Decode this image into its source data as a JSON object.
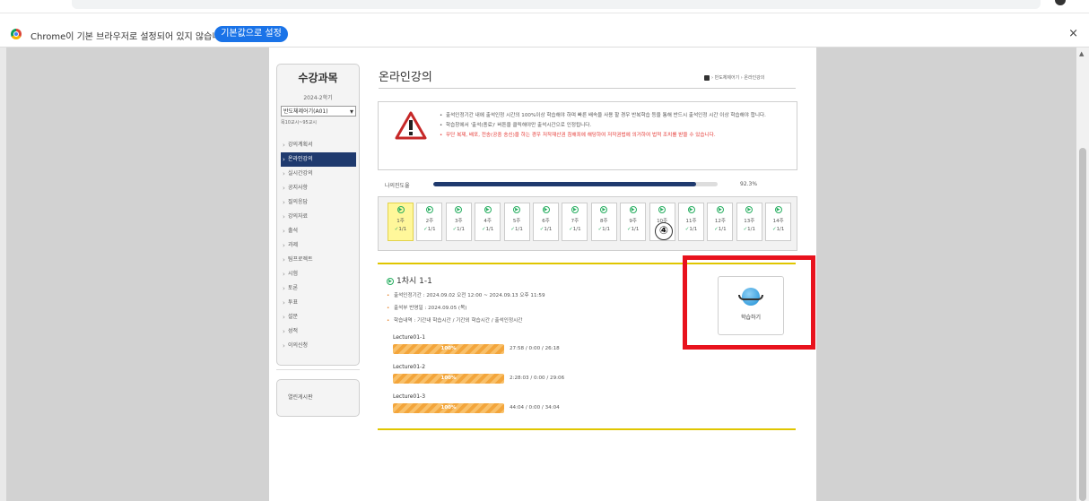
{
  "infobar": {
    "message": "Chrome이 기본 브라우저로 설정되어 있지 않습니다",
    "button_label": "기본값으로 설정",
    "close_glyph": "×"
  },
  "scrollbar": {
    "up_glyph": "▲"
  },
  "sidebar": {
    "title": "수강과목",
    "semester": "2024-2학기",
    "course_select": "반도체제어기(A01)",
    "course_sub": "목10교시~95교시",
    "menu": [
      "강의계획서",
      "온라인강의",
      "실시간강의",
      "공지사항",
      "질의응답",
      "강의자료",
      "출석",
      "과제",
      "팀프로젝트",
      "시험",
      "토론",
      "투표",
      "설문",
      "성적",
      "이의신청"
    ],
    "active_index": 1,
    "board": "열린게시판"
  },
  "main": {
    "title": "온라인강의",
    "breadcrumb": "› 반도체제어기 › 온라인강의",
    "notices": [
      {
        "text": "출석인정기간 내에 출석인정 시간의 100%이상 학습해야 하며 빠른 배속을 사용 할 경우 반복학습 등을 통해 반드시 출석인정 시간 이상 학습해야 합니다.",
        "red": false
      },
      {
        "text": "학습창에서 '출석(종료)' 버튼을 클릭해야만 출석시간으로 인정됩니다.",
        "red": false
      },
      {
        "text": "무단 복제, 배포, 전송(공중 송신)을 하는 경우 저작재산권 침해죄에 해당하여 저작권법에 의거하여 법적 조치를 받을 수 있습니다.",
        "red": true
      }
    ],
    "progress": {
      "label": "나의진도율",
      "percent_text": "92.3%",
      "value": 0.923
    },
    "weeks": [
      {
        "label": "1주",
        "status": "1/1",
        "current": true
      },
      {
        "label": "2주",
        "status": "1/1",
        "current": false
      },
      {
        "label": "3주",
        "status": "1/1",
        "current": false
      },
      {
        "label": "4주",
        "status": "1/1",
        "current": false
      },
      {
        "label": "5주",
        "status": "1/1",
        "current": false
      },
      {
        "label": "6주",
        "status": "1/1",
        "current": false
      },
      {
        "label": "7주",
        "status": "1/1",
        "current": false
      },
      {
        "label": "8주",
        "status": "1/1",
        "current": false
      },
      {
        "label": "9주",
        "status": "1/1",
        "current": false
      },
      {
        "label": "10주",
        "status": "1/1",
        "current": false
      },
      {
        "label": "11주",
        "status": "1/1",
        "current": false
      },
      {
        "label": "12주",
        "status": "1/1",
        "current": false
      },
      {
        "label": "13주",
        "status": "1/1",
        "current": false
      },
      {
        "label": "14주",
        "status": "1/1",
        "current": false
      }
    ],
    "callout_marker": "④",
    "session": {
      "title": "1차시 1-1",
      "info": [
        "출석인정기간 : 2024.09.02 오전 12:00 ~ 2024.09.13 오후 11:59",
        "출석부 반영일 : 2024.09.05 (목)",
        "학습내역 : 기간내 학습시간 / 기간외 학습시간 / 출석인정시간"
      ],
      "lectures": [
        {
          "name": "Lecture01-1",
          "percent": "100%",
          "time": "27:58 / 0:00 / 26:18"
        },
        {
          "name": "Lecture01-2",
          "percent": "100%",
          "time": "2:28:03 / 0:00 / 29:06"
        },
        {
          "name": "Lecture01-3",
          "percent": "100%",
          "time": "44:04 / 0:00 / 34:04"
        }
      ]
    },
    "study_button": "학습하기"
  },
  "colors": {
    "navy": "#1f3a6e",
    "chrome_blue": "#1a73e8",
    "highlight_red": "#e8121d",
    "progress_orange": "#f3a53b",
    "week_current": "#fff79a"
  }
}
